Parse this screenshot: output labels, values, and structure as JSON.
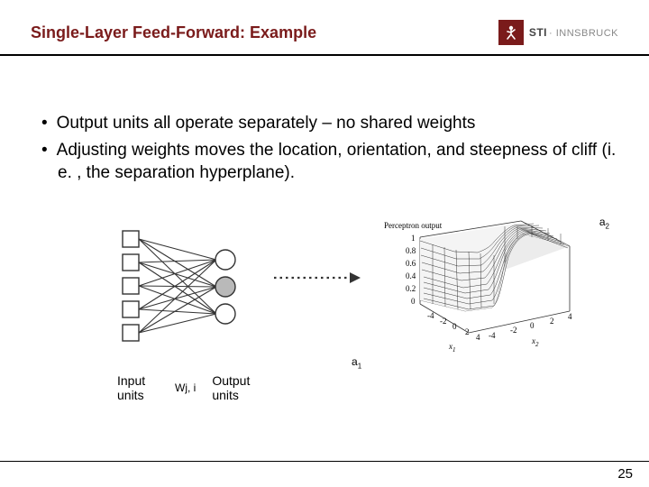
{
  "header": {
    "title": "Single-Layer Feed-Forward: Example",
    "logo_main": "STI",
    "logo_sub": "· INNSBRUCK"
  },
  "bullets": [
    "Output units all operate separately – no shared weights",
    "Adjusting weights moves the location, orientation, and steepness of cliff (i. e. , the separation hyperplane)."
  ],
  "nn": {
    "input_label": "Input units",
    "weight_label": "Wj, i",
    "output_label": "Output units"
  },
  "plot": {
    "zlabel": "Perceptron output",
    "zticks": [
      "1",
      "0.8",
      "0.6",
      "0.4",
      "0.2",
      "0"
    ],
    "xticks": [
      "-4",
      "-2",
      "0",
      "2",
      "4"
    ],
    "yticks": [
      "-4",
      "-2",
      "0",
      "2",
      "4"
    ],
    "xaxis": "x",
    "yaxis": "x",
    "a1": "a",
    "a2": "a"
  },
  "page_number": "25",
  "chart_data": {
    "type": "heatmap",
    "title": "Perceptron output",
    "xlabel": "x1",
    "ylabel": "x2",
    "zlabel": "Perceptron output",
    "xlim": [
      -4,
      4
    ],
    "ylim": [
      -4,
      4
    ],
    "zlim": [
      0,
      1
    ],
    "note": "Sigmoid/step surface over 2D input showing separation hyperplane; output rises from ~0 to ~1 across the cliff."
  }
}
